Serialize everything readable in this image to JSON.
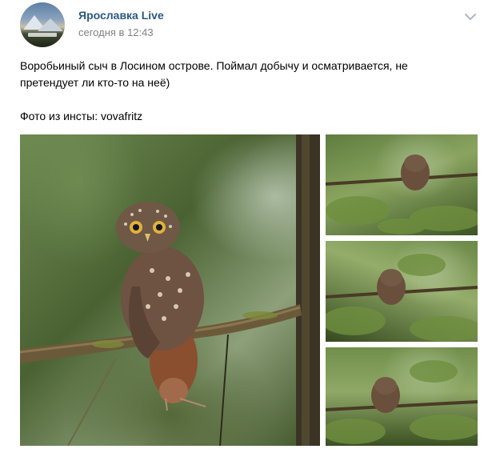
{
  "post": {
    "author": "Ярославка Live",
    "time": "сегодня в 12:43",
    "text_line1": "Воробьиный сыч в Лосином острове. Поймал добычу и осматривается, не",
    "text_line2": "претендует ли кто-то на неё)",
    "text_line3": "Фото из инсты: vovafritz"
  },
  "icons": {
    "menu": "chevron-down-icon",
    "avatar": "avatar"
  },
  "colors": {
    "author": "#2a5885",
    "time": "#828282",
    "text": "#000000",
    "menu": "#aeb7c2"
  }
}
